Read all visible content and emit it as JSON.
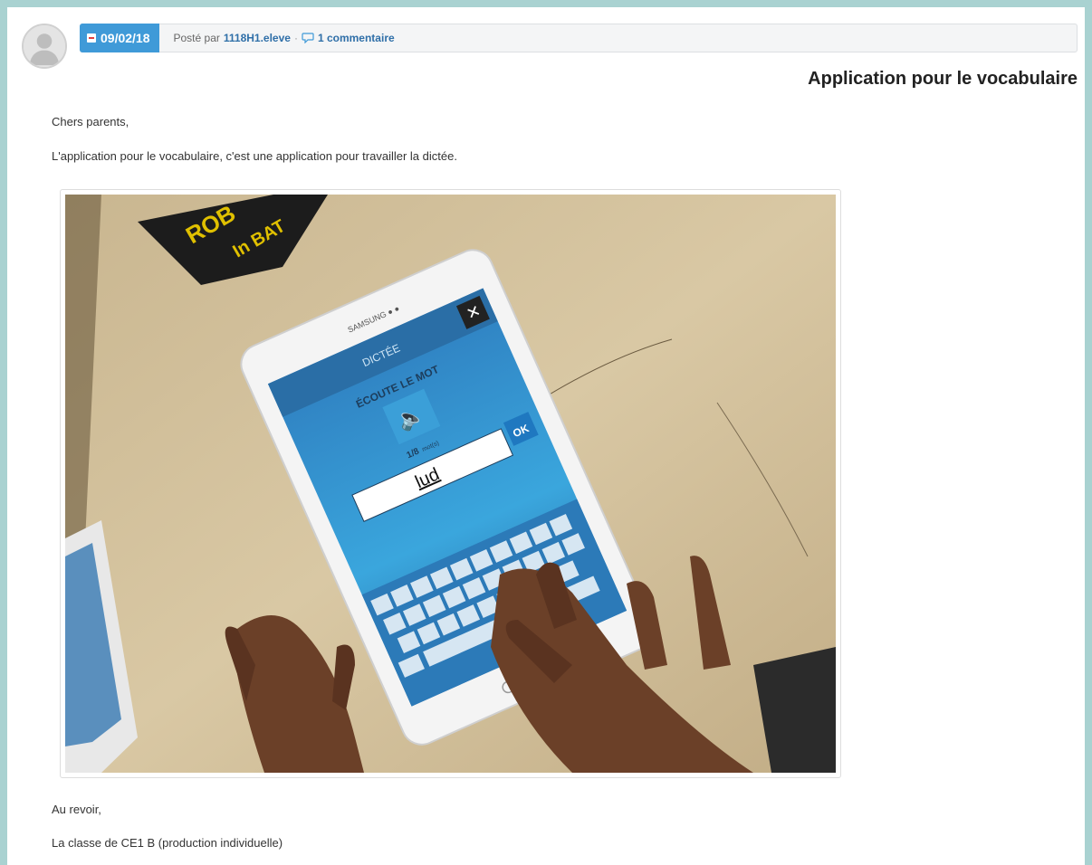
{
  "post": {
    "date": "09/02/18",
    "posted_by_label": "Posté par",
    "author": "1118H1.eleve",
    "separator": "·",
    "comments": "1 commentaire",
    "title": "Application pour le vocabulaire"
  },
  "body": {
    "greeting": "Chers parents,",
    "intro": "L'application pour le vocabulaire, c'est une application pour travailler la dictée.",
    "closing": "Au revoir,",
    "signature": "La classe de CE1 B (production individuelle)"
  },
  "photo": {
    "tablet_brand": "SAMSUNG",
    "app_header": "DICTÉE",
    "prompt": "ÉCOUTE LE MOT",
    "progress": "1/8",
    "progress_unit": "mot(s)",
    "typed_word": "lud",
    "ok_label": "OK"
  },
  "icons": {
    "avatar": "user-silhouette-icon",
    "date": "calendar-icon",
    "comments": "speech-bubble-icon"
  },
  "colors": {
    "frame": "#a9d2d1",
    "date_badge": "#3f9ad8",
    "link": "#2f6fa8"
  }
}
